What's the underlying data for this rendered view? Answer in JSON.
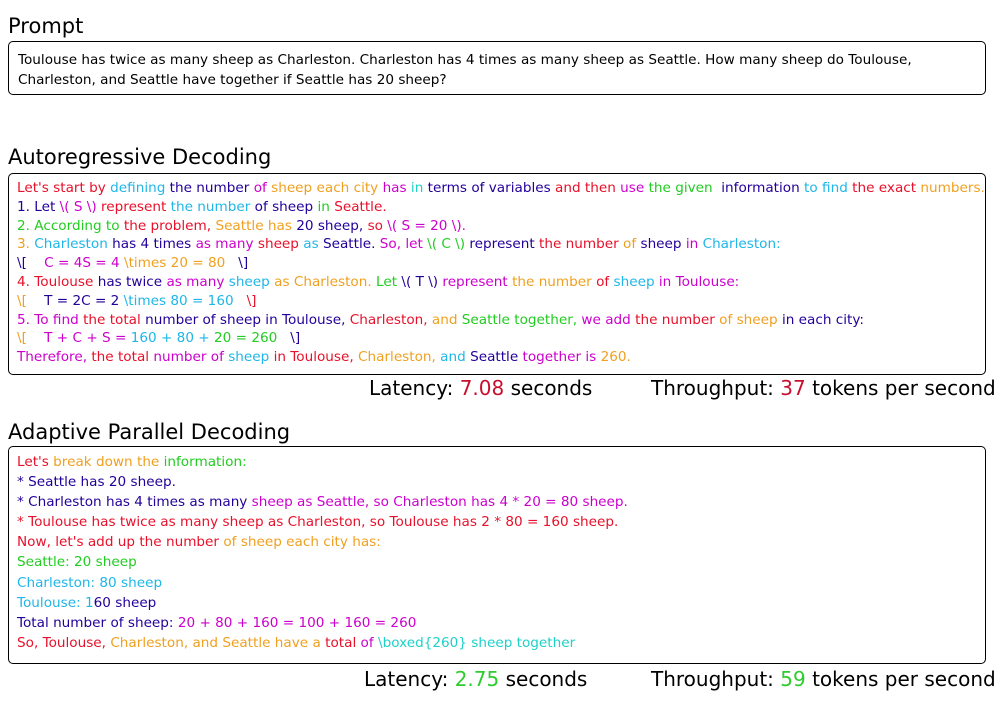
{
  "colors": {
    "latency_slow": "#c8102e",
    "throughput_slow": "#c8102e",
    "latency_fast": "#2ecc2e",
    "throughput_fast": "#2ecc2e"
  },
  "prompt": {
    "heading": "Prompt",
    "text": "Toulouse has twice as many sheep as Charleston. Charleston has 4 times as many sheep as Seattle. How many sheep do Toulouse, Charleston, and Seattle have together if Seattle has 20 sheep?"
  },
  "autoregressive": {
    "heading": "Autoregressive Decoding",
    "lines": [
      [
        [
          "Let's start ",
          "#e8102a"
        ],
        [
          "by ",
          "#e8102a"
        ],
        [
          "defining ",
          "#1fb6e8"
        ],
        [
          "the number ",
          "#220099"
        ],
        [
          "of ",
          "#cc00cc"
        ],
        [
          "sheep ",
          "#f0a020"
        ],
        [
          "each city ",
          "#f0a020"
        ],
        [
          "has ",
          "#cc00cc"
        ],
        [
          "in ",
          "#1fd1c7"
        ],
        [
          "terms ",
          "#220099"
        ],
        [
          "of variables ",
          "#220099"
        ],
        [
          "and then ",
          "#e8102a"
        ],
        [
          "use ",
          "#cc00cc"
        ],
        [
          "the given  ",
          "#22cc22"
        ],
        [
          "information ",
          "#220099"
        ],
        [
          "to find ",
          "#1fb6e8"
        ],
        [
          "the exact ",
          "#e8102a"
        ],
        [
          "numbers.",
          "#f0a020"
        ]
      ],
      [
        [
          "1. Let ",
          "#220099"
        ],
        [
          "\\( S \\) ",
          "#cc00cc"
        ],
        [
          "represent ",
          "#e8102a"
        ],
        [
          "the number ",
          "#1fb6e8"
        ],
        [
          "of sheep ",
          "#220099"
        ],
        [
          "in ",
          "#22cc22"
        ],
        [
          "Seattle.",
          "#e8102a"
        ]
      ],
      [
        [
          "2. According to ",
          "#22cc22"
        ],
        [
          "the problem, ",
          "#e8102a"
        ],
        [
          "Seattle has ",
          "#f0a020"
        ],
        [
          "20 sheep, ",
          "#220099"
        ],
        [
          "so ",
          "#e8102a"
        ],
        [
          "\\( S = 20 \\).",
          "#cc00cc"
        ]
      ],
      [
        [
          "3. ",
          "#f0a020"
        ],
        [
          "Charleston ",
          "#1fb6e8"
        ],
        [
          "has 4 times ",
          "#220099"
        ],
        [
          "as many ",
          "#cc00cc"
        ],
        [
          "sheep ",
          "#e8102a"
        ],
        [
          "as ",
          "#1fb6e8"
        ],
        [
          "Seattle. ",
          "#220099"
        ],
        [
          "So, let ",
          "#cc00cc"
        ],
        [
          "\\( C \\) ",
          "#22cc22"
        ],
        [
          "represent ",
          "#220099"
        ],
        [
          "the number ",
          "#e8102a"
        ],
        [
          "of ",
          "#f0a020"
        ],
        [
          "sheep ",
          "#220099"
        ],
        [
          "in ",
          "#cc00cc"
        ],
        [
          "Charleston:",
          "#1fb6e8"
        ]
      ],
      [
        [
          "\\[    ",
          "#220099"
        ],
        [
          "C = 4S = 4 ",
          "#cc00cc"
        ],
        [
          "\\times 20 = 80",
          "#f0a020"
        ],
        [
          "   \\]",
          "#220099"
        ]
      ],
      [
        [
          "4. Toulouse ",
          "#e8102a"
        ],
        [
          "has twice ",
          "#220099"
        ],
        [
          "as many ",
          "#cc00cc"
        ],
        [
          "sheep ",
          "#1fb6e8"
        ],
        [
          "as Charleston. ",
          "#f0a020"
        ],
        [
          "Let ",
          "#22cc22"
        ],
        [
          "\\( T \\) ",
          "#220099"
        ],
        [
          "represent ",
          "#cc00cc"
        ],
        [
          "the number ",
          "#f0a020"
        ],
        [
          "of ",
          "#e8102a"
        ],
        [
          "sheep ",
          "#1fb6e8"
        ],
        [
          "in Toulouse:",
          "#cc00cc"
        ]
      ],
      [
        [
          "\\[    ",
          "#f0a020"
        ],
        [
          "T = 2C = 2 ",
          "#220099"
        ],
        [
          "\\times 80 = 160",
          "#1fb6e8"
        ],
        [
          "   \\]",
          "#e8102a"
        ]
      ],
      [
        [
          "5. To find ",
          "#cc00cc"
        ],
        [
          "the total ",
          "#e8102a"
        ],
        [
          "number of sheep ",
          "#220099"
        ],
        [
          "in Toulouse, ",
          "#220099"
        ],
        [
          "Charleston, ",
          "#e8102a"
        ],
        [
          "and ",
          "#f0a020"
        ],
        [
          "Seattle together, ",
          "#22cc22"
        ],
        [
          "we add ",
          "#cc00cc"
        ],
        [
          "the number ",
          "#e8102a"
        ],
        [
          "of sheep ",
          "#f0a020"
        ],
        [
          "in each city:",
          "#220099"
        ]
      ],
      [
        [
          "\\[    ",
          "#f0a020"
        ],
        [
          "T + C + S = ",
          "#cc00cc"
        ],
        [
          "160 + 80 + ",
          "#1fb6e8"
        ],
        [
          "20 = 260",
          "#22cc22"
        ],
        [
          "   \\]",
          "#220099"
        ]
      ],
      [
        [
          "Therefore, ",
          "#cc00cc"
        ],
        [
          "the total ",
          "#e8102a"
        ],
        [
          "number of ",
          "#cc00cc"
        ],
        [
          "sheep ",
          "#1fb6e8"
        ],
        [
          "in Toulouse, ",
          "#e8102a"
        ],
        [
          "Charleston, ",
          "#f0a020"
        ],
        [
          "and ",
          "#1fb6e8"
        ],
        [
          "Seattle ",
          "#220099"
        ],
        [
          "together is ",
          "#cc00cc"
        ],
        [
          "260.",
          "#f0a020"
        ]
      ]
    ],
    "latency_label": "Latency: ",
    "latency_value": "7.08",
    "latency_unit": " seconds",
    "throughput_label": "Throughput: ",
    "throughput_value": "37",
    "throughput_unit": " tokens per second"
  },
  "adaptive": {
    "heading": "Adaptive Parallel Decoding",
    "lines": [
      [
        [
          "Let's ",
          "#e8102a"
        ],
        [
          "break down ",
          "#f0a020"
        ],
        [
          "the ",
          "#f0a020"
        ],
        [
          "information:",
          "#22cc22"
        ]
      ],
      [
        [
          "* Seattle has 20 sheep.",
          "#220099"
        ]
      ],
      [
        [
          "* Charleston has 4 times as many ",
          "#220099"
        ],
        [
          "sheep as Seattle, so Charleston has 4 ",
          "#cc00cc"
        ],
        [
          "* 20 = 80 sheep.",
          "#cc00cc"
        ]
      ],
      [
        [
          "* Toulouse has twice as many sheep as Charleston, so Toulouse has 2 * 80 = 160 sheep.",
          "#e8102a"
        ]
      ],
      [
        [
          "Now, let's add up the number ",
          "#e8102a"
        ],
        [
          "of ",
          "#f0a020"
        ],
        [
          "sheep each city has:",
          "#f0a020"
        ]
      ],
      [
        [
          "Seattle",
          "#22cc22"
        ],
        [
          ": 20 sheep",
          "#22cc22"
        ]
      ],
      [
        [
          "Charleston: 80 sheep",
          "#1fb6e8"
        ]
      ],
      [
        [
          "Toulouse: 1",
          "#1fb6e8"
        ],
        [
          "60 sheep",
          "#220099"
        ]
      ],
      [
        [
          "Total number of sheep: ",
          "#220099"
        ],
        [
          "20 + 80 + 160 = 100 + 160 = 260",
          "#cc00cc"
        ]
      ],
      [
        [
          "So, Toulouse, ",
          "#e8102a"
        ],
        [
          "Charleston, ",
          "#f0a020"
        ],
        [
          "and Seattle have a ",
          "#f0a020"
        ],
        [
          "total ",
          "#e8102a"
        ],
        [
          "of ",
          "#cc00cc"
        ],
        [
          "\\boxed{260} sheep together",
          "#1fd1c7"
        ]
      ]
    ],
    "latency_label": "Latency: ",
    "latency_value": "2.75",
    "latency_unit": " seconds",
    "throughput_label": "Throughput: ",
    "throughput_value": "59",
    "throughput_unit": " tokens per second"
  }
}
